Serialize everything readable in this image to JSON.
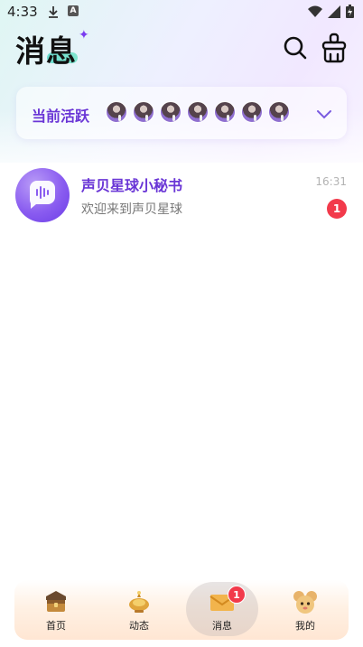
{
  "status_bar": {
    "time": "4:33",
    "notif_a": "A"
  },
  "header": {
    "title": "消息"
  },
  "active_section": {
    "label": "当前活跃",
    "avatar_count": 7
  },
  "conversations": [
    {
      "name": "声贝星球小秘书",
      "preview": "欢迎来到声贝星球",
      "time": "16:31",
      "unread": "1"
    }
  ],
  "bottom_nav": {
    "items": [
      {
        "label": "首页"
      },
      {
        "label": "动态"
      },
      {
        "label": "消息",
        "badge": "1"
      },
      {
        "label": "我的"
      }
    ]
  },
  "colors": {
    "accent": "#6a36d6",
    "badge": "#f23a4b"
  }
}
